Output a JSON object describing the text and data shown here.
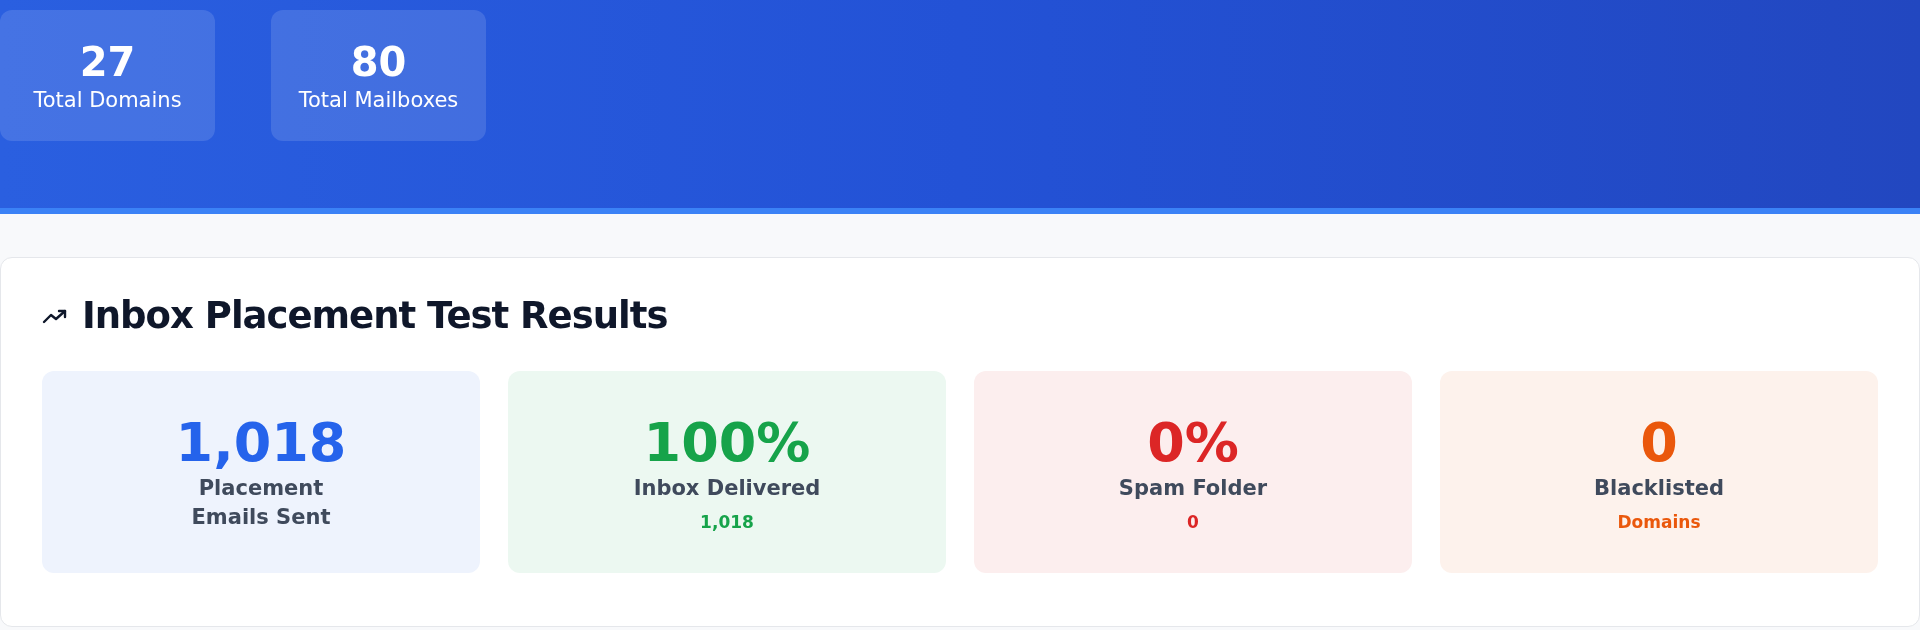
{
  "header_stats": [
    {
      "value": "27",
      "label": "Total Domains"
    },
    {
      "value": "80",
      "label": "Total Mailboxes"
    }
  ],
  "results": {
    "title": "Inbox Placement Test Results",
    "cards": [
      {
        "value": "1,018",
        "label_lines": [
          "Placement",
          "Emails Sent"
        ],
        "color": "#2563eb"
      },
      {
        "value": "100%",
        "label_lines": [
          "Inbox Delivered"
        ],
        "sub": "1,018",
        "color": "#16a34a"
      },
      {
        "value": "0%",
        "label_lines": [
          "Spam Folder"
        ],
        "sub": "0",
        "color": "#dc2626"
      },
      {
        "value": "0",
        "label_lines": [
          "Blacklisted"
        ],
        "sub": "Domains",
        "color": "#ea580c"
      }
    ]
  }
}
